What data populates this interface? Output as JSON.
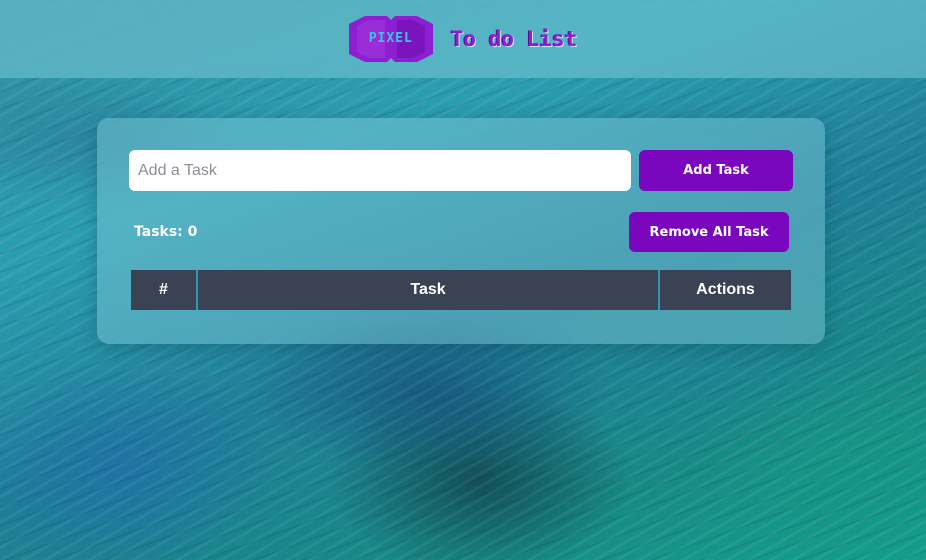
{
  "header": {
    "logo_text": "PIXEL",
    "title": "To do List"
  },
  "form": {
    "placeholder": "Add a Task",
    "value": "",
    "add_label": "Add Task"
  },
  "status": {
    "count_text": "Tasks: 0",
    "remove_all_label": "Remove All Task"
  },
  "table": {
    "columns": [
      "#",
      "Task",
      "Actions"
    ]
  },
  "colors": {
    "accent": "#7a07be",
    "table_header": "#3b4254",
    "logo_cyan": "#37c6e6"
  }
}
